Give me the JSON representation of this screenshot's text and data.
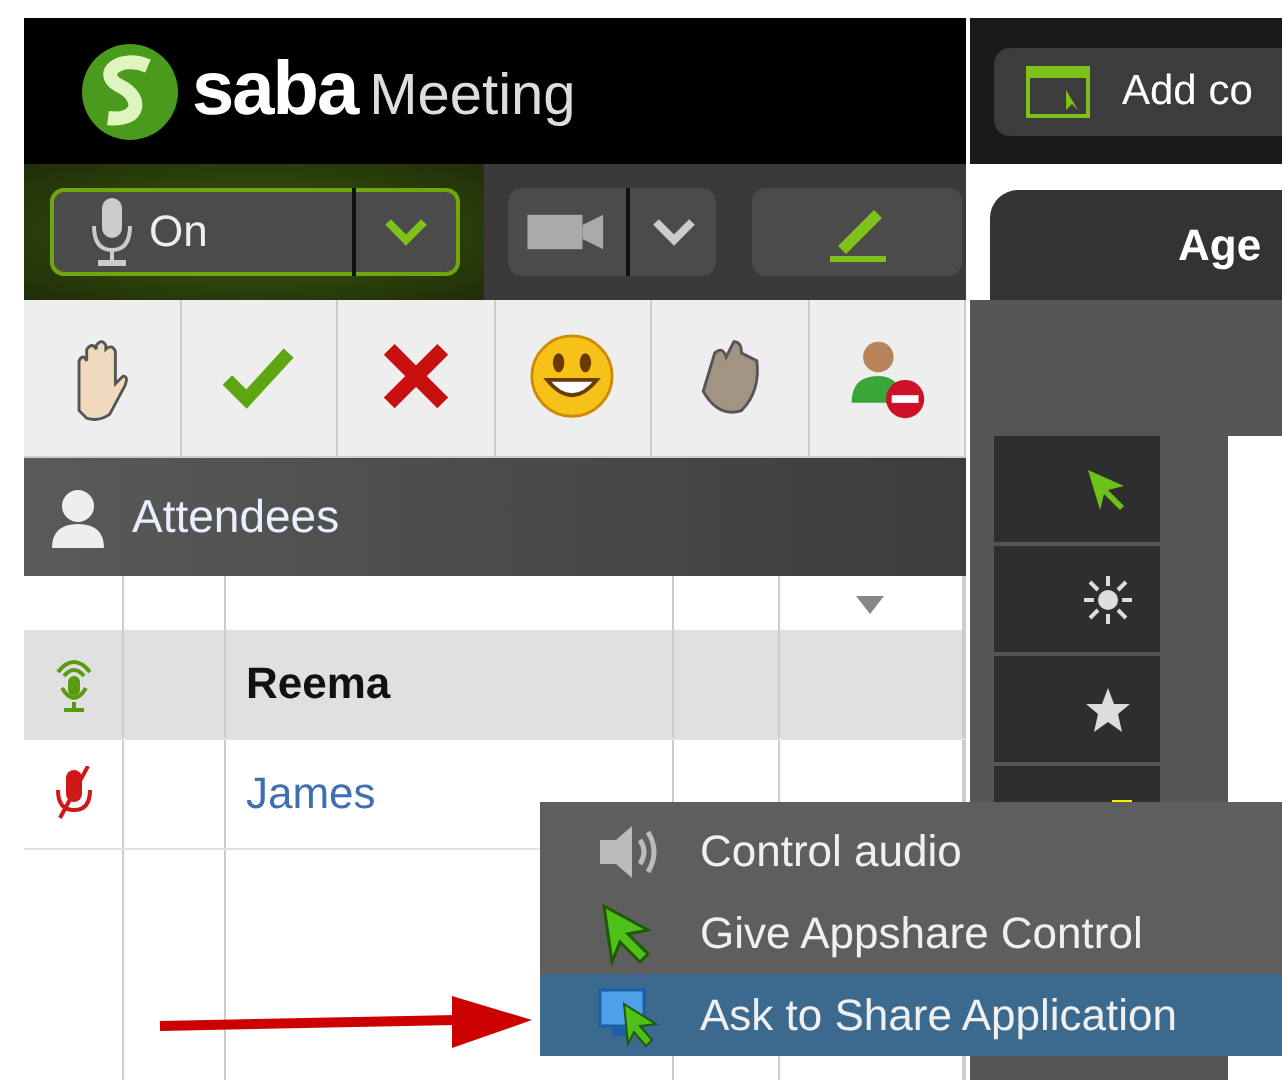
{
  "logo": {
    "brand": "saba",
    "product": "Meeting"
  },
  "toolbar": {
    "add_button": "Add co"
  },
  "audio": {
    "label": "On",
    "on": true
  },
  "attendees_panel": {
    "title": "Attendees"
  },
  "attendees": [
    {
      "name": "Reema",
      "muted": false,
      "selected": true
    },
    {
      "name": "James",
      "muted": true,
      "selected": false
    }
  ],
  "tab": {
    "label": "Age",
    "selected": true
  },
  "context_menu": {
    "items": [
      {
        "kind": "audio",
        "label": "Control audio",
        "selected": false
      },
      {
        "kind": "pointer",
        "label": "Give Appshare Control",
        "selected": false
      },
      {
        "kind": "share",
        "label": "Ask to Share Application",
        "selected": true
      }
    ]
  }
}
